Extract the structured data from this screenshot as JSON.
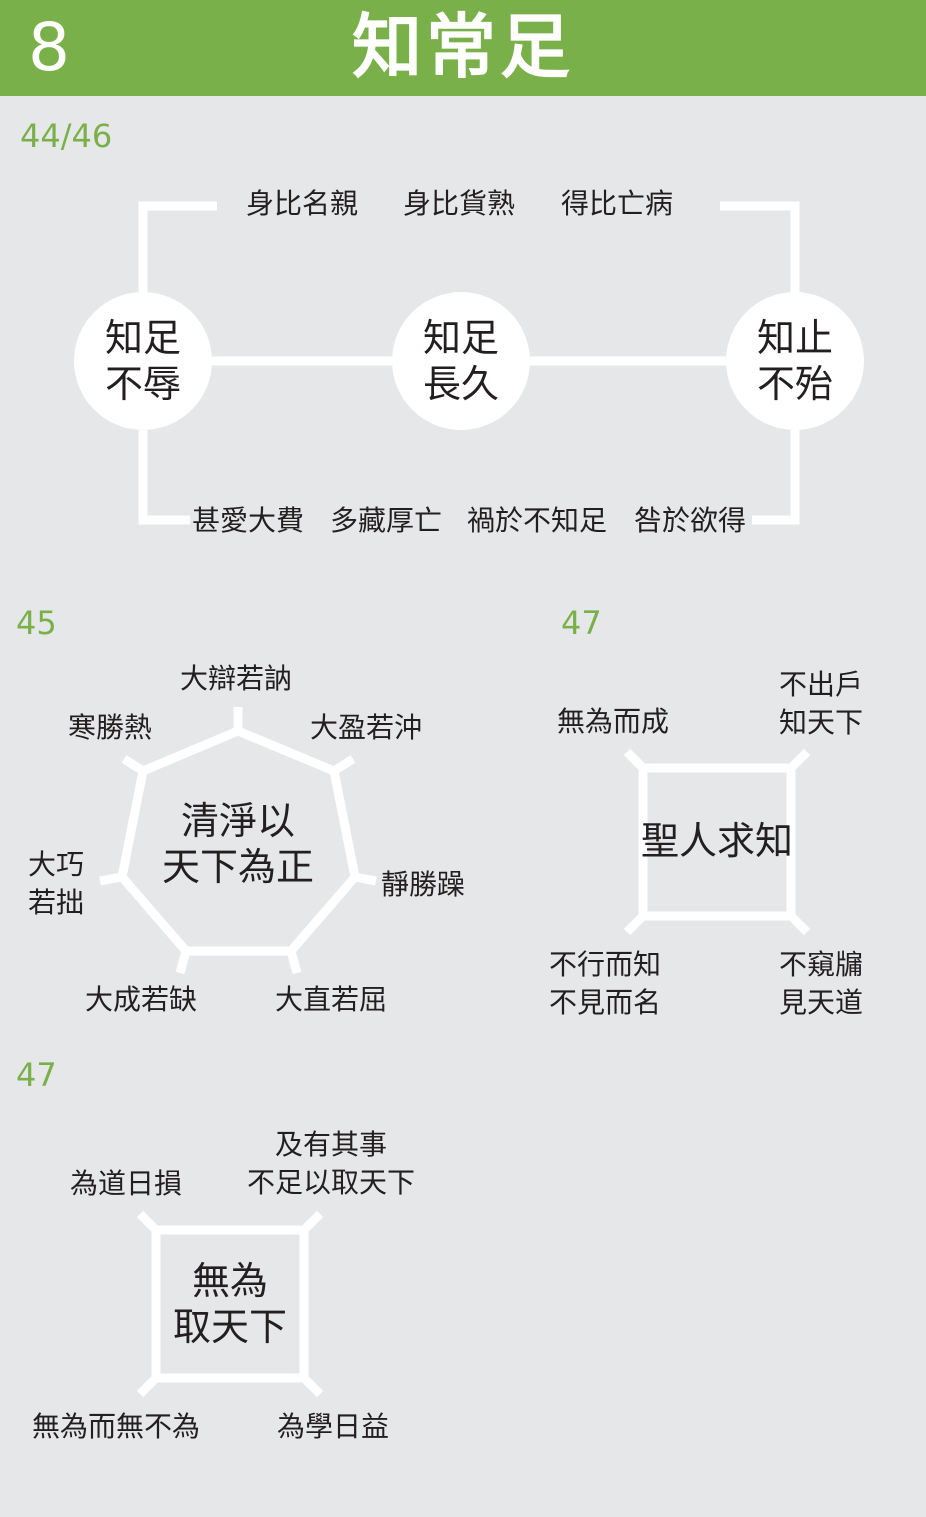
{
  "header": {
    "number": "8",
    "title": "知常足"
  },
  "section1": {
    "label": "44/46",
    "top_phrases": [
      "身比名親",
      "身比貨熟",
      "得比亡病"
    ],
    "nodes": [
      "知足\n不辱",
      "知足\n長久",
      "知止\n不殆"
    ],
    "bottom_phrases": [
      "甚愛大費",
      "多藏厚亡",
      "禍於不知足",
      "咎於欲得"
    ]
  },
  "section2": {
    "label": "45",
    "center": "清淨以\n天下為正",
    "outer": {
      "top": "大辯若訥",
      "upper_left": "寒勝熱",
      "upper_right": "大盈若沖",
      "left": "大巧\n若拙",
      "right": "靜勝躁",
      "lower_left": "大成若缺",
      "lower_right": "大直若屈"
    }
  },
  "section3": {
    "label": "47",
    "center": "聖人求知",
    "top_left": "無為而成",
    "top_right": "不出戶\n知天下",
    "bottom_left": "不行而知\n不見而名",
    "bottom_right": "不窺牖\n見天道"
  },
  "section4": {
    "label": "47",
    "center": "無為\n取天下",
    "top_left": "為道日損",
    "top_right": "及有其事\n不足以取天下",
    "bottom_left": "無為而無不為",
    "bottom_right": "為學日益"
  },
  "colors": {
    "accent": "#7ab04a",
    "background": "#e6e7e8",
    "line": "#ffffff",
    "text": "#231f20"
  }
}
